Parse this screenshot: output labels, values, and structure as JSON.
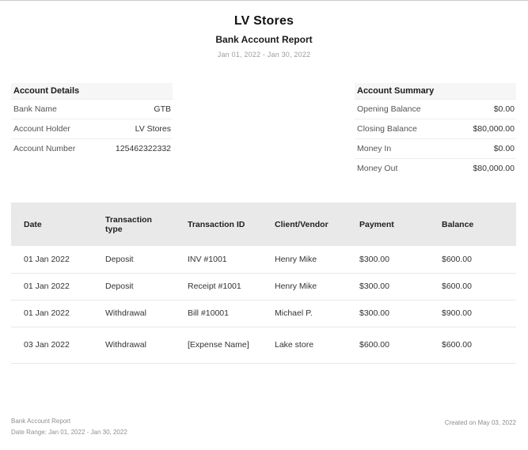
{
  "page": {
    "title": "LV Stores",
    "subtitle": "Bank Account Report",
    "date_range": "Jan 01, 2022 - Jan 30, 2022"
  },
  "account_details": {
    "heading": "Account Details",
    "rows": [
      {
        "label": "Bank Name",
        "value": "GTB"
      },
      {
        "label": "Account Holder",
        "value": "LV Stores"
      },
      {
        "label": "Account Number",
        "value": "125462322332"
      }
    ]
  },
  "account_summary": {
    "heading": "Account Summary",
    "rows": [
      {
        "label": "Opening Balance",
        "value": "$0.00"
      },
      {
        "label": "Closing Balance",
        "value": "$80,000.00"
      },
      {
        "label": "Money In",
        "value": "$0.00"
      },
      {
        "label": "Money Out",
        "value": "$80,000.00"
      }
    ]
  },
  "transactions": {
    "columns": [
      "Date",
      "Transaction type",
      "Transaction ID",
      "Client/Vendor",
      "Payment",
      "Balance"
    ],
    "rows": [
      [
        "01 Jan 2022",
        "Deposit",
        "INV #1001",
        "Henry Mike",
        "$300.00",
        "$600.00"
      ],
      [
        "01 Jan 2022",
        "Deposit",
        "Receipt #1001",
        "Henry Mike",
        "$300.00",
        "$600.00"
      ],
      [
        "01 Jan 2022",
        "Withdrawal",
        "Bill #10001",
        "Michael P.",
        "$300.00",
        "$900.00"
      ],
      [
        "03 Jan 2022",
        "Withdrawal",
        "[Expense Name]",
        "Lake store",
        "$600.00",
        "$600.00"
      ]
    ]
  },
  "footer": {
    "report_name": "Bank Account Report",
    "date_range_line": "Date Range: Jan 01, 2022 - Jan 30, 2022",
    "created_on": "Created on May 03, 2022"
  },
  "colors": {
    "table_header_bg": "#e9e9e9",
    "section_header_bg": "#f6f6f6",
    "divider": "#e8e8e8",
    "text_primary": "#1a1a1a",
    "text_secondary": "#555555",
    "text_muted": "#9d9d9d"
  }
}
